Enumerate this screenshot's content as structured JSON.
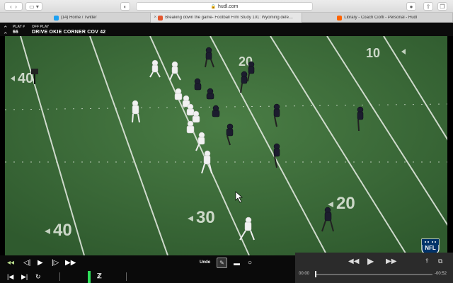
{
  "browser": {
    "url": "hudl.com",
    "tabs": [
      {
        "label": "(14) Home / Twitter",
        "favicon_color": "#1da1f2",
        "active": false
      },
      {
        "label": "Breaking down the game- Football Film Study 101: Wyoming defens...",
        "favicon_color": "#e4572e",
        "active": true
      },
      {
        "label": "Library - Coach Cioffi - Personal - Hudl",
        "favicon_color": "#ff6300",
        "active": false
      }
    ]
  },
  "header": {
    "play_label": "PLAY #",
    "play_number": "66",
    "type_label": "OFF PLAY",
    "play_name": "DRIVE OKIE CORNER COV 42"
  },
  "field": {
    "yard_numbers": [
      "40",
      "30",
      "20",
      "10",
      "20",
      "30",
      "40"
    ]
  },
  "controls": {
    "undo_label": "Undo"
  },
  "player": {
    "current_time": "00:00",
    "remaining_time": "-00:52"
  },
  "colors": {
    "field": "#3c6a39",
    "offense": "#f2f2f2",
    "defense": "#1c1c2e",
    "highlight": "#2ee05a"
  }
}
